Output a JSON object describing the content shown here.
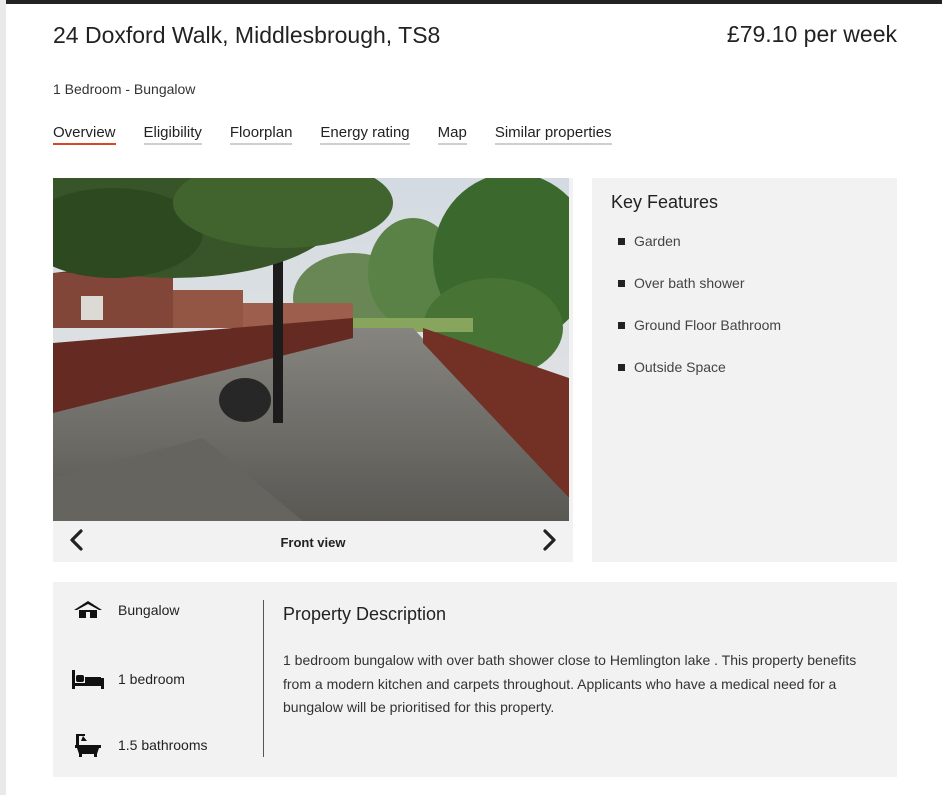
{
  "property": {
    "title": "24 Doxford Walk, Middlesbrough, TS8",
    "price": "£79.10 per week",
    "subtitle": "1 Bedroom - Bungalow"
  },
  "tabs": [
    {
      "label": "Overview",
      "active": true
    },
    {
      "label": "Eligibility"
    },
    {
      "label": "Floorplan"
    },
    {
      "label": "Energy rating"
    },
    {
      "label": "Map"
    },
    {
      "label": "Similar properties"
    }
  ],
  "gallery": {
    "caption": "Front view",
    "prev_icon": "chevron-left-icon",
    "next_icon": "chevron-right-icon"
  },
  "key_features": {
    "title": "Key Features",
    "items": [
      "Garden",
      "Over bath shower",
      "Ground Floor Bathroom",
      "Outside Space"
    ]
  },
  "specs": [
    {
      "icon": "house-icon",
      "label": "Bungalow"
    },
    {
      "icon": "bed-icon",
      "label": "1 bedroom"
    },
    {
      "icon": "bath-icon",
      "label": "1.5 bathrooms"
    }
  ],
  "description": {
    "title": "Property Description",
    "text": "1 bedroom bungalow with over bath shower close to Hemlington lake . This property benefits from a modern kitchen and carpets throughout. Applicants who have a medical need for a bungalow will be prioritised for this property."
  },
  "colors": {
    "accent": "#d9472b",
    "panel": "#f2f2f2",
    "text": "#222222"
  }
}
